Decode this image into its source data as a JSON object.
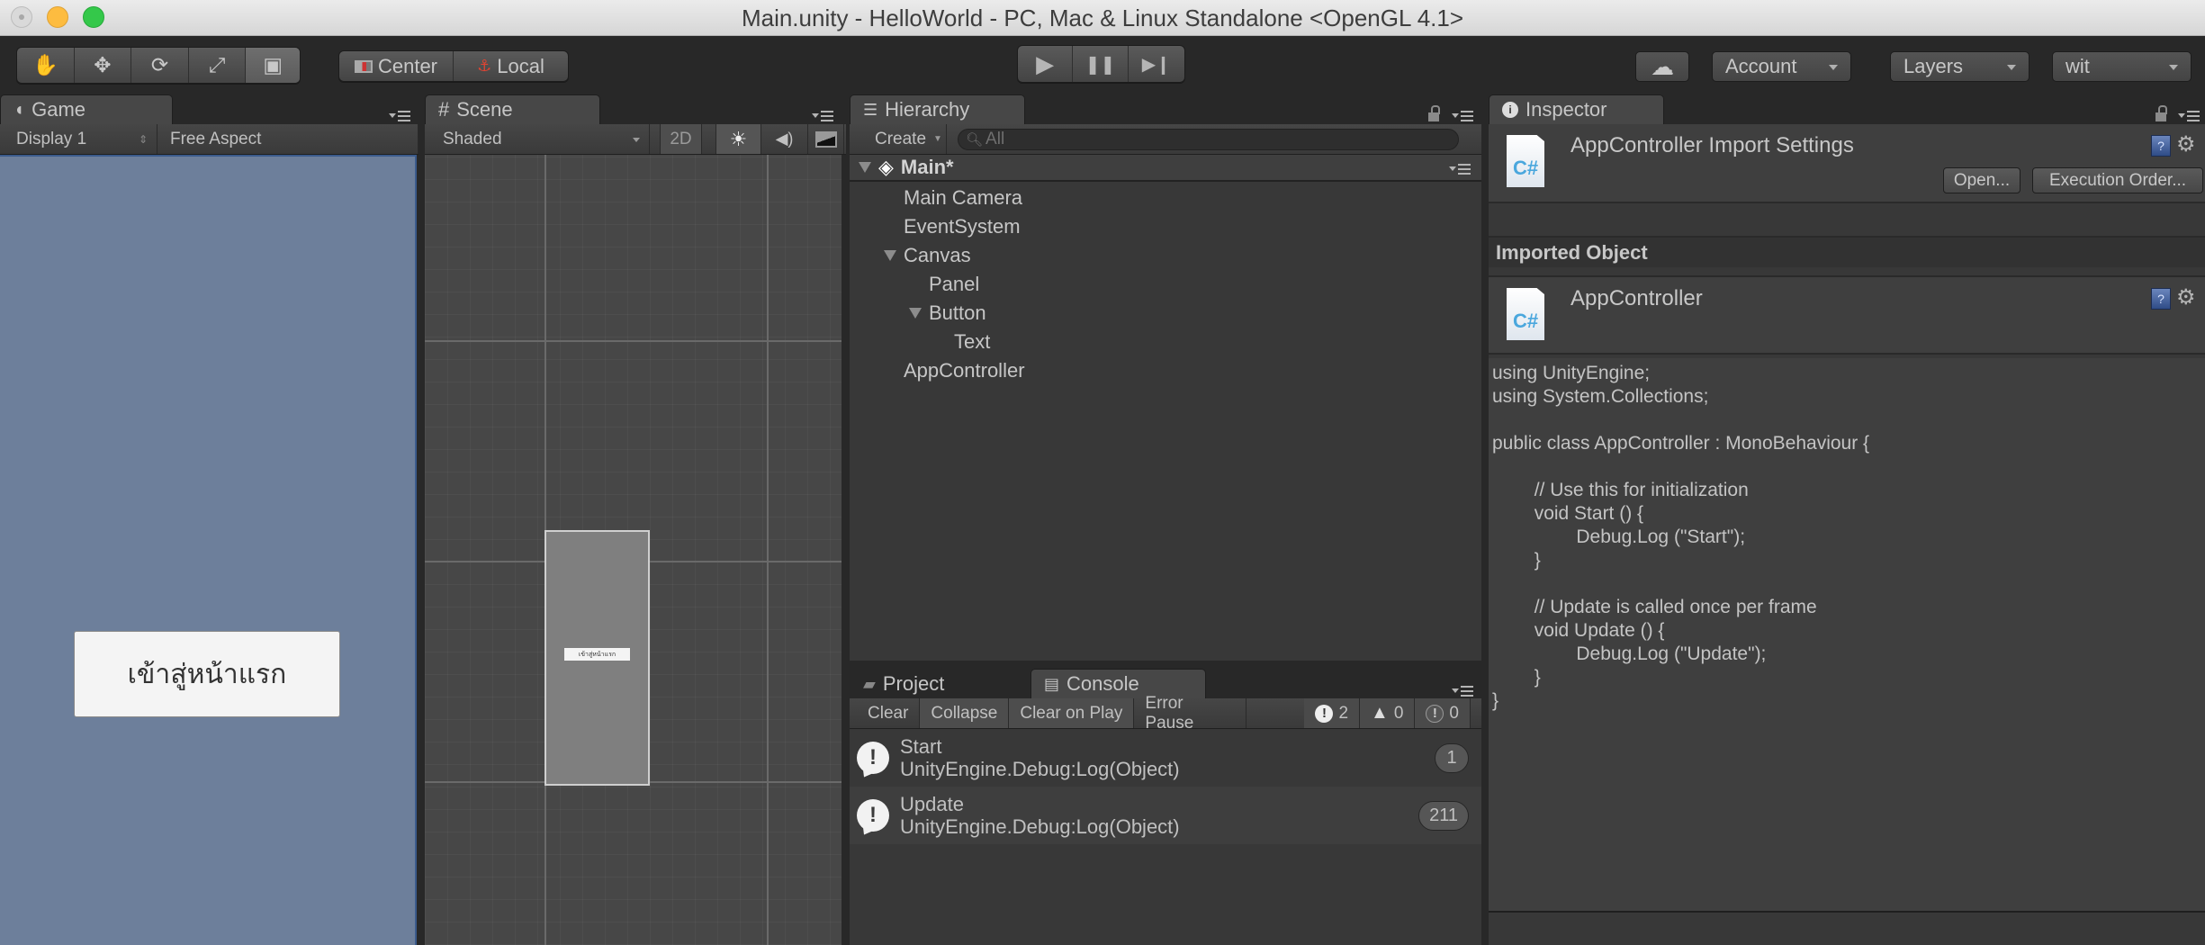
{
  "window": {
    "title": "Main.unity - HelloWorld - PC, Mac & Linux Standalone <OpenGL 4.1>"
  },
  "toolbar": {
    "tools": [
      {
        "name": "hand-tool",
        "icon": "hand-icon",
        "glyph": "✋"
      },
      {
        "name": "move-tool",
        "icon": "move-icon",
        "glyph": "✥"
      },
      {
        "name": "rotate-tool",
        "icon": "rotate-icon",
        "glyph": "⟳"
      },
      {
        "name": "scale-tool",
        "icon": "scale-icon",
        "glyph": "⤢"
      },
      {
        "name": "rect-tool",
        "icon": "rect-icon",
        "glyph": "▣",
        "active": true
      }
    ],
    "pivot_mode": "Center",
    "pivot_rotation": "Local",
    "play_glyph": "▶",
    "pause_glyph": "❚❚",
    "step_glyph": "▶❙",
    "cloud_glyph": "☁",
    "account_label": "Account",
    "layers_label": "Layers",
    "layout_label": "wit"
  },
  "game": {
    "tab_label": "Game",
    "display": "Display 1",
    "aspect": "Free Aspect",
    "button_text": "เข้าสู่หน้าแรก",
    "bg_color": "#6d7f9b"
  },
  "scene": {
    "tab_label": "Scene",
    "shading": "Shaded",
    "mode_2d": "2D",
    "button_text": "เข้าสู่หน้าแรก"
  },
  "hierarchy": {
    "tab_label": "Hierarchy",
    "create_label": "Create",
    "search_placeholder": "All",
    "scene_name": "Main*",
    "items": [
      {
        "label": "Main Camera",
        "depth": 0,
        "expanded": null
      },
      {
        "label": "EventSystem",
        "depth": 0,
        "expanded": null
      },
      {
        "label": "Canvas",
        "depth": 0,
        "expanded": true
      },
      {
        "label": "Panel",
        "depth": 1,
        "expanded": null
      },
      {
        "label": "Button",
        "depth": 1,
        "expanded": true
      },
      {
        "label": "Text",
        "depth": 2,
        "expanded": null
      },
      {
        "label": "AppController",
        "depth": 0,
        "expanded": null
      }
    ]
  },
  "console": {
    "project_tab": "Project",
    "console_tab": "Console",
    "buttons": {
      "clear": "Clear",
      "collapse": "Collapse",
      "clear_on_play": "Clear on Play",
      "error_pause": "Error Pause"
    },
    "counts": {
      "info": "2",
      "warning": "0",
      "error": "0"
    },
    "logs": [
      {
        "title": "Start",
        "detail": "UnityEngine.Debug:Log(Object)",
        "count": "1"
      },
      {
        "title": "Update",
        "detail": "UnityEngine.Debug:Log(Object)",
        "count": "211"
      }
    ]
  },
  "inspector": {
    "tab_label": "Inspector",
    "import_title": "AppController Import Settings",
    "open_button": "Open...",
    "execution_order_button": "Execution Order...",
    "imported_object_label": "Imported Object",
    "object_name": "AppController",
    "file_icon_text": "C#",
    "code": "using UnityEngine;\nusing System.Collections;\n\npublic class AppController : MonoBehaviour {\n\n\t// Use this for initialization\n\tvoid Start () {\n\t\tDebug.Log (\"Start\");\n\t}\n\n\t// Update is called once per frame\n\tvoid Update () {\n\t\tDebug.Log (\"Update\");\n\t}\n}"
  }
}
